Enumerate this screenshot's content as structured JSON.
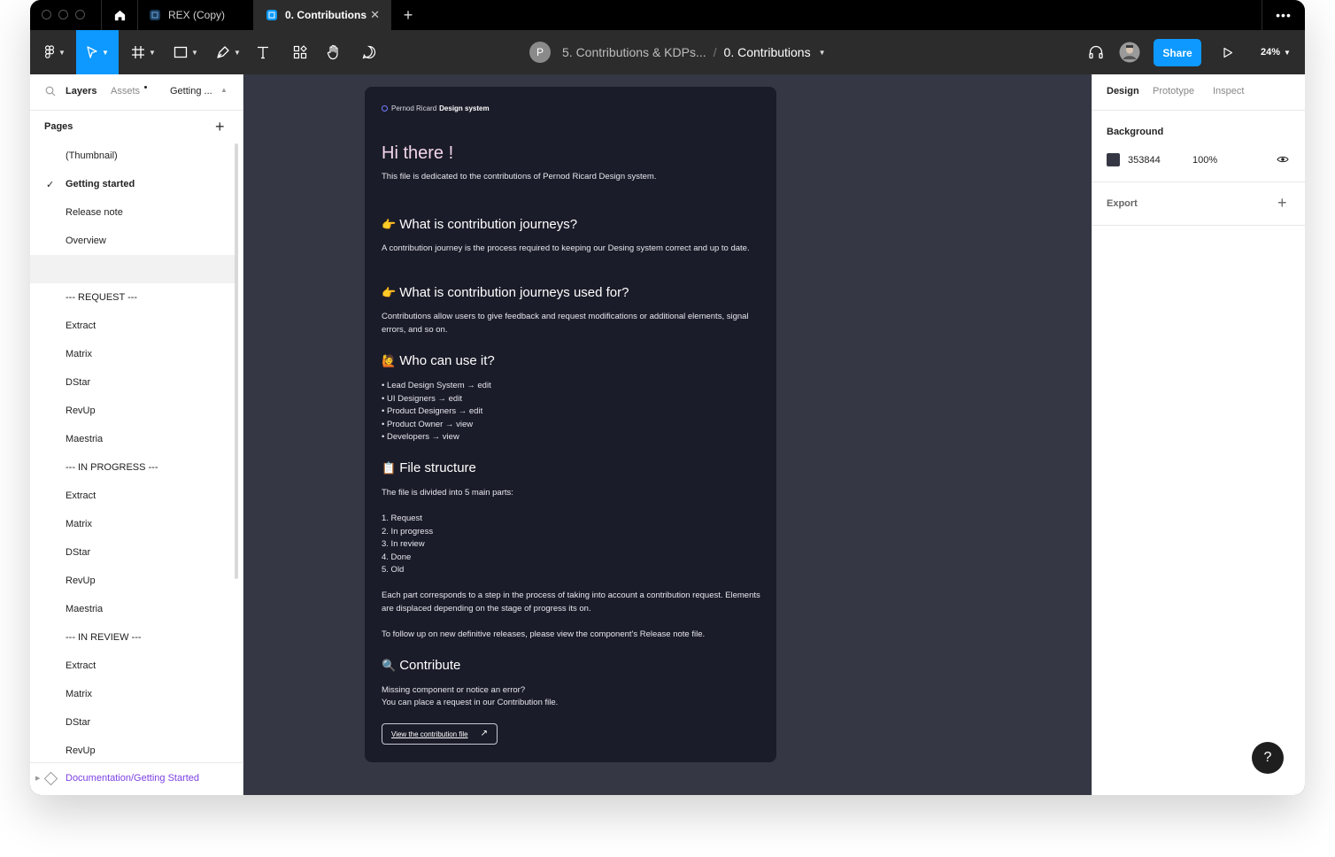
{
  "tabs": {
    "items": [
      {
        "label": "REX (Copy)"
      },
      {
        "label": "0. Contributions"
      }
    ],
    "close_glyph": "✕",
    "new_glyph": "+",
    "more_glyph": "•••"
  },
  "toolbar": {
    "project_initial": "P",
    "project": "5. Contributions & KDPs...",
    "separator": "/",
    "file": "0. Contributions",
    "share_label": "Share",
    "zoom": "24%",
    "accent": "#0d99ff"
  },
  "left_panel": {
    "tab_layers": "Layers",
    "tab_assets": "Assets",
    "tab_page": "Getting ...",
    "pages_title": "Pages",
    "pages": [
      {
        "label": "(Thumbnail)"
      },
      {
        "label": "Getting started",
        "current": true
      },
      {
        "label": "Release note"
      },
      {
        "label": "Overview"
      },
      {
        "label": ""
      },
      {
        "label": "--- REQUEST ---"
      },
      {
        "label": "Extract"
      },
      {
        "label": "Matrix"
      },
      {
        "label": "DStar"
      },
      {
        "label": "RevUp"
      },
      {
        "label": "Maestria"
      },
      {
        "label": "--- IN PROGRESS ---"
      },
      {
        "label": "Extract"
      },
      {
        "label": "Matrix"
      },
      {
        "label": "DStar"
      },
      {
        "label": "RevUp"
      },
      {
        "label": "Maestria"
      },
      {
        "label": "--- IN REVIEW ---"
      },
      {
        "label": "Extract"
      },
      {
        "label": "Matrix"
      },
      {
        "label": "DStar"
      },
      {
        "label": "RevUp"
      }
    ],
    "layer": "Documentation/Getting Started"
  },
  "frame": {
    "brand_light": "Pernod Ricard",
    "brand_bold": "Design system",
    "greeting": "Hi there !",
    "intro": "This file is dedicated to the contributions of Pernod Ricard Design system.",
    "s1_title": "What is contribution journeys?",
    "s1_body": "A contribution journey is the process required to keeping our Desing system correct and up to date.",
    "s2_title": "What is contribution journeys used for?",
    "s2_body": "Contributions allow users to give feedback and request modifications or additional elements, signal errors, and so on.",
    "s3_title": "Who can use it?",
    "s3_list": [
      "•  Lead Design System → edit",
      "•  UI Designers → edit",
      "•  Product Designers → edit",
      "•  Product Owner → view",
      "•  Developers → view"
    ],
    "s4_title": "File structure",
    "s4_intro": "The file is divided into 5 main parts:",
    "s4_list": [
      "1.  Request",
      "2.  In progress",
      "3.  In review",
      "4.  Done",
      "5.  Old"
    ],
    "s4_body": "Each part corresponds to a step in the process of taking into account a contribution request. Elements are displaced depending on the stage of progress its on.",
    "s4_follow": "To follow up on new definitive releases, please view the component's Release note file.",
    "s5_title": "Contribute",
    "s5_line1": "Missing component or notice an error?",
    "s5_line2": "You can place a request in our  Contribution file.",
    "button": "View the contribution file",
    "button_arrow": "↗"
  },
  "right_panel": {
    "tab_design": "Design",
    "tab_prototype": "Prototype",
    "tab_inspect": "Inspect",
    "bg_title": "Background",
    "bg_hex": "353844",
    "bg_opacity": "100%",
    "bg_color": "#353844",
    "export_title": "Export",
    "help": "?"
  }
}
